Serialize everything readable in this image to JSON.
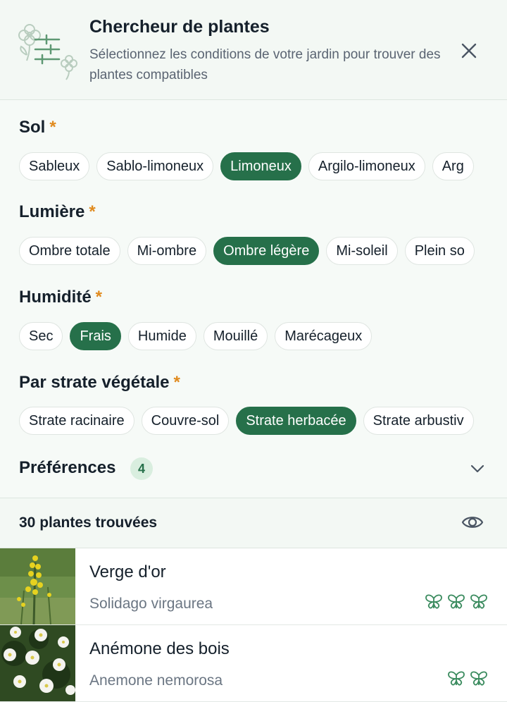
{
  "header": {
    "title": "Chercheur de plantes",
    "subtitle": "Sélectionnez les conditions de votre jardin pour trouver des plantes compatibles",
    "illustration_icon": "garden-filter-illustration",
    "close_icon": "close-icon"
  },
  "filters": {
    "soil": {
      "label": "Sol",
      "required_mark": "*",
      "options": [
        "Sableux",
        "Sablo-limoneux",
        "Limoneux",
        "Argilo-limoneux",
        "Arg"
      ],
      "selected": "Limoneux"
    },
    "light": {
      "label": "Lumière",
      "required_mark": "*",
      "options": [
        "Ombre totale",
        "Mi-ombre",
        "Ombre légère",
        "Mi-soleil",
        "Plein so"
      ],
      "selected": "Ombre légère"
    },
    "humidity": {
      "label": "Humidité",
      "required_mark": "*",
      "options": [
        "Sec",
        "Frais",
        "Humide",
        "Mouillé",
        "Marécageux"
      ],
      "selected": "Frais"
    },
    "strata": {
      "label": "Par strate végétale",
      "required_mark": "*",
      "options": [
        "Strate racinaire",
        "Couvre-sol",
        "Strate herbacée",
        "Strate arbustiv"
      ],
      "selected": "Strate herbacée"
    },
    "preferences": {
      "label": "Préférences",
      "count": "4",
      "chevron_icon": "chevron-down-icon"
    }
  },
  "results": {
    "count_label": "30 plantes trouvées",
    "view_icon": "eye-icon",
    "plants": [
      {
        "name": "Verge d'or",
        "latin": "Solidago virgaurea",
        "pollinator_rating": 3,
        "icon": "butterfly-icon"
      },
      {
        "name": "Anémone des bois",
        "latin": "Anemone nemorosa",
        "pollinator_rating": 2,
        "icon": "butterfly-icon"
      }
    ]
  },
  "colors": {
    "accent": "#26704a",
    "required": "#e08a1e",
    "badge_bg": "#d9eedf",
    "header_bg": "#f3f8f4"
  }
}
